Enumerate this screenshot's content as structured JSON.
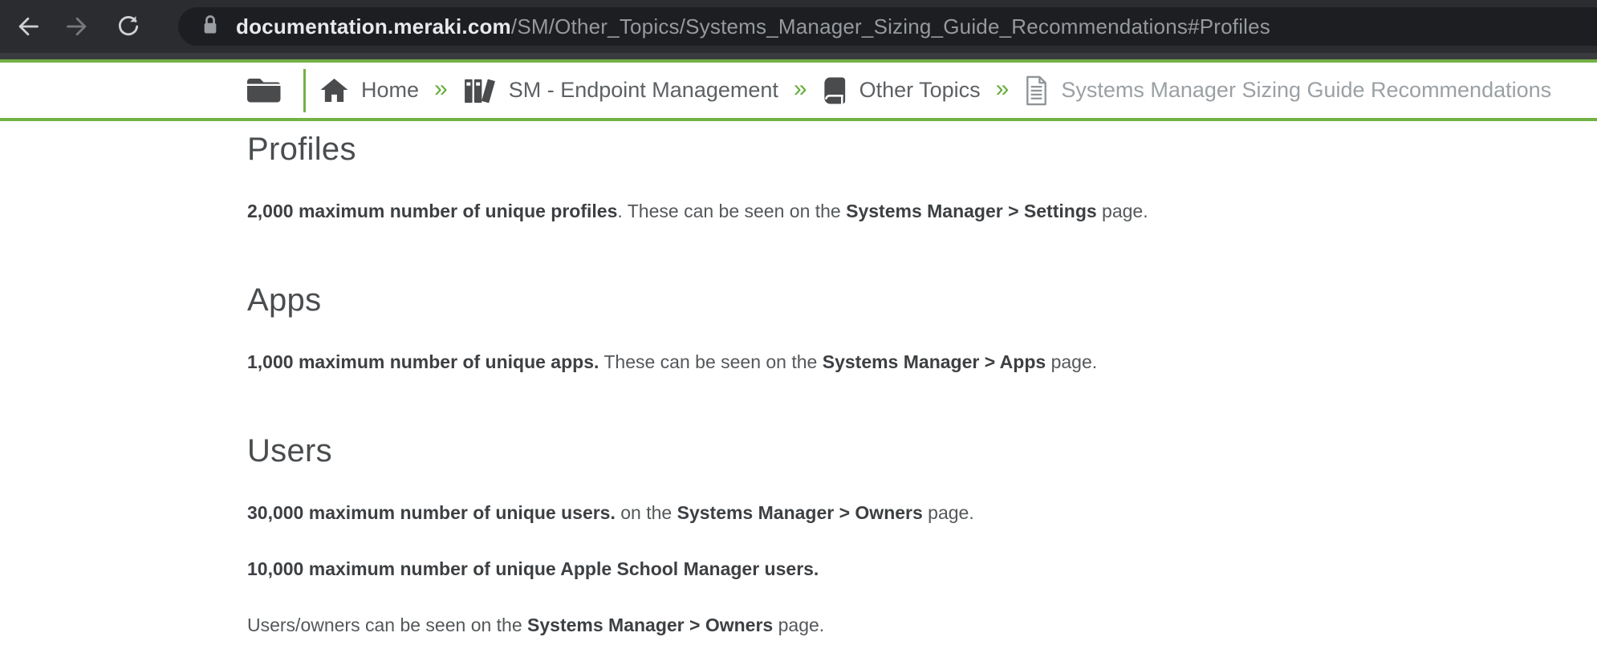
{
  "browser": {
    "url_domain": "documentation.meraki.com",
    "url_path": "/SM/Other_Topics/Systems_Manager_Sizing_Guide_Recommendations#Profiles"
  },
  "breadcrumb": {
    "separator": "»",
    "items": [
      {
        "label": "Home",
        "icon": "home-icon"
      },
      {
        "label": "SM - Endpoint Management",
        "icon": "library-icon"
      },
      {
        "label": "Other Topics",
        "icon": "book-icon"
      },
      {
        "label": "Systems Manager Sizing Guide Recommendations",
        "icon": "document-icon"
      }
    ]
  },
  "content": {
    "sections": [
      {
        "heading": "Profiles",
        "paragraphs": [
          [
            {
              "t": "2,000 maximum number of unique profiles",
              "b": true
            },
            {
              "t": ". These can be seen on the ",
              "b": false
            },
            {
              "t": "Systems Manager > Settings",
              "b": true
            },
            {
              "t": " page.",
              "b": false
            }
          ]
        ]
      },
      {
        "heading": "Apps",
        "paragraphs": [
          [
            {
              "t": "1,000 maximum number of unique apps.",
              "b": true
            },
            {
              "t": " These can be seen on the ",
              "b": false
            },
            {
              "t": "Systems Manager > Apps",
              "b": true
            },
            {
              "t": " page.",
              "b": false
            }
          ]
        ]
      },
      {
        "heading": "Users",
        "paragraphs": [
          [
            {
              "t": "30,000 maximum number of unique users.",
              "b": true
            },
            {
              "t": " on the ",
              "b": false
            },
            {
              "t": "Systems Manager > Owners",
              "b": true
            },
            {
              "t": " page.",
              "b": false
            }
          ],
          [
            {
              "t": "10,000 maximum number of unique Apple School Manager users.",
              "b": true
            }
          ],
          [
            {
              "t": "Users/owners can be seen on the ",
              "b": false
            },
            {
              "t": "Systems Manager > Owners",
              "b": true
            },
            {
              "t": " page.",
              "b": false
            }
          ]
        ]
      }
    ]
  },
  "theme": {
    "accent_green": "#72b246",
    "toolbar_dark": "#2b2c2f",
    "omnibox_dark": "#1d1e21"
  }
}
